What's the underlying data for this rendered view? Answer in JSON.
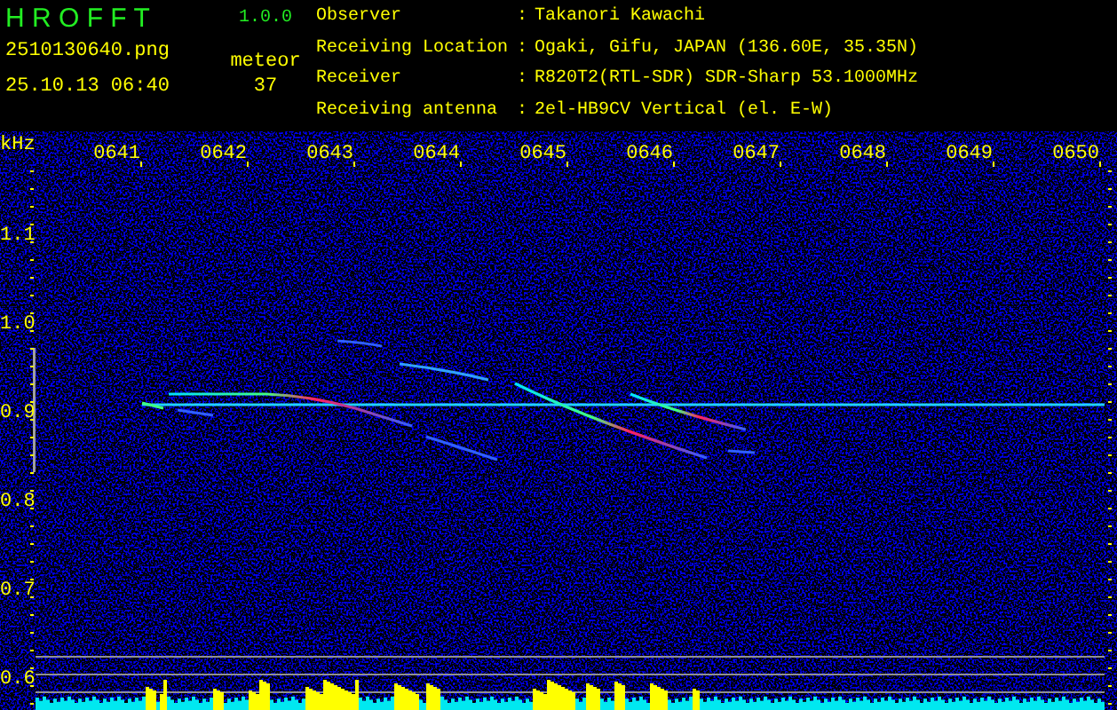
{
  "header": {
    "title": "H R O F F T",
    "version": "1.0.0",
    "filename": "2510130640.png",
    "datetime": "25.10.13 06:40",
    "meteor_label": "meteor",
    "meteor_count": "37"
  },
  "station_info": [
    {
      "label": "Observer",
      "separator": ":",
      "value": "Takanori Kawachi"
    },
    {
      "label": "Receiving Location",
      "separator": ":",
      "value": "Ogaki, Gifu, JAPAN (136.60E, 35.35N)"
    },
    {
      "label": "Receiver",
      "separator": ":",
      "value": "R820T2(RTL-SDR) SDR-Sharp 53.1000MHz"
    },
    {
      "label": "Receiving antenna",
      "separator": ":",
      "value": "2el-HB9CV Vertical (el. E-W)"
    }
  ],
  "spectrogram": {
    "unit": "kHz",
    "time_labels": [
      "0641",
      "0642",
      "0643",
      "0644",
      "0645",
      "0646",
      "0647",
      "0648",
      "0649",
      "0650"
    ],
    "frequency_labels": [
      "1.1",
      "1.0",
      "0.9",
      "0.8",
      "0.7",
      "0.6"
    ]
  }
}
